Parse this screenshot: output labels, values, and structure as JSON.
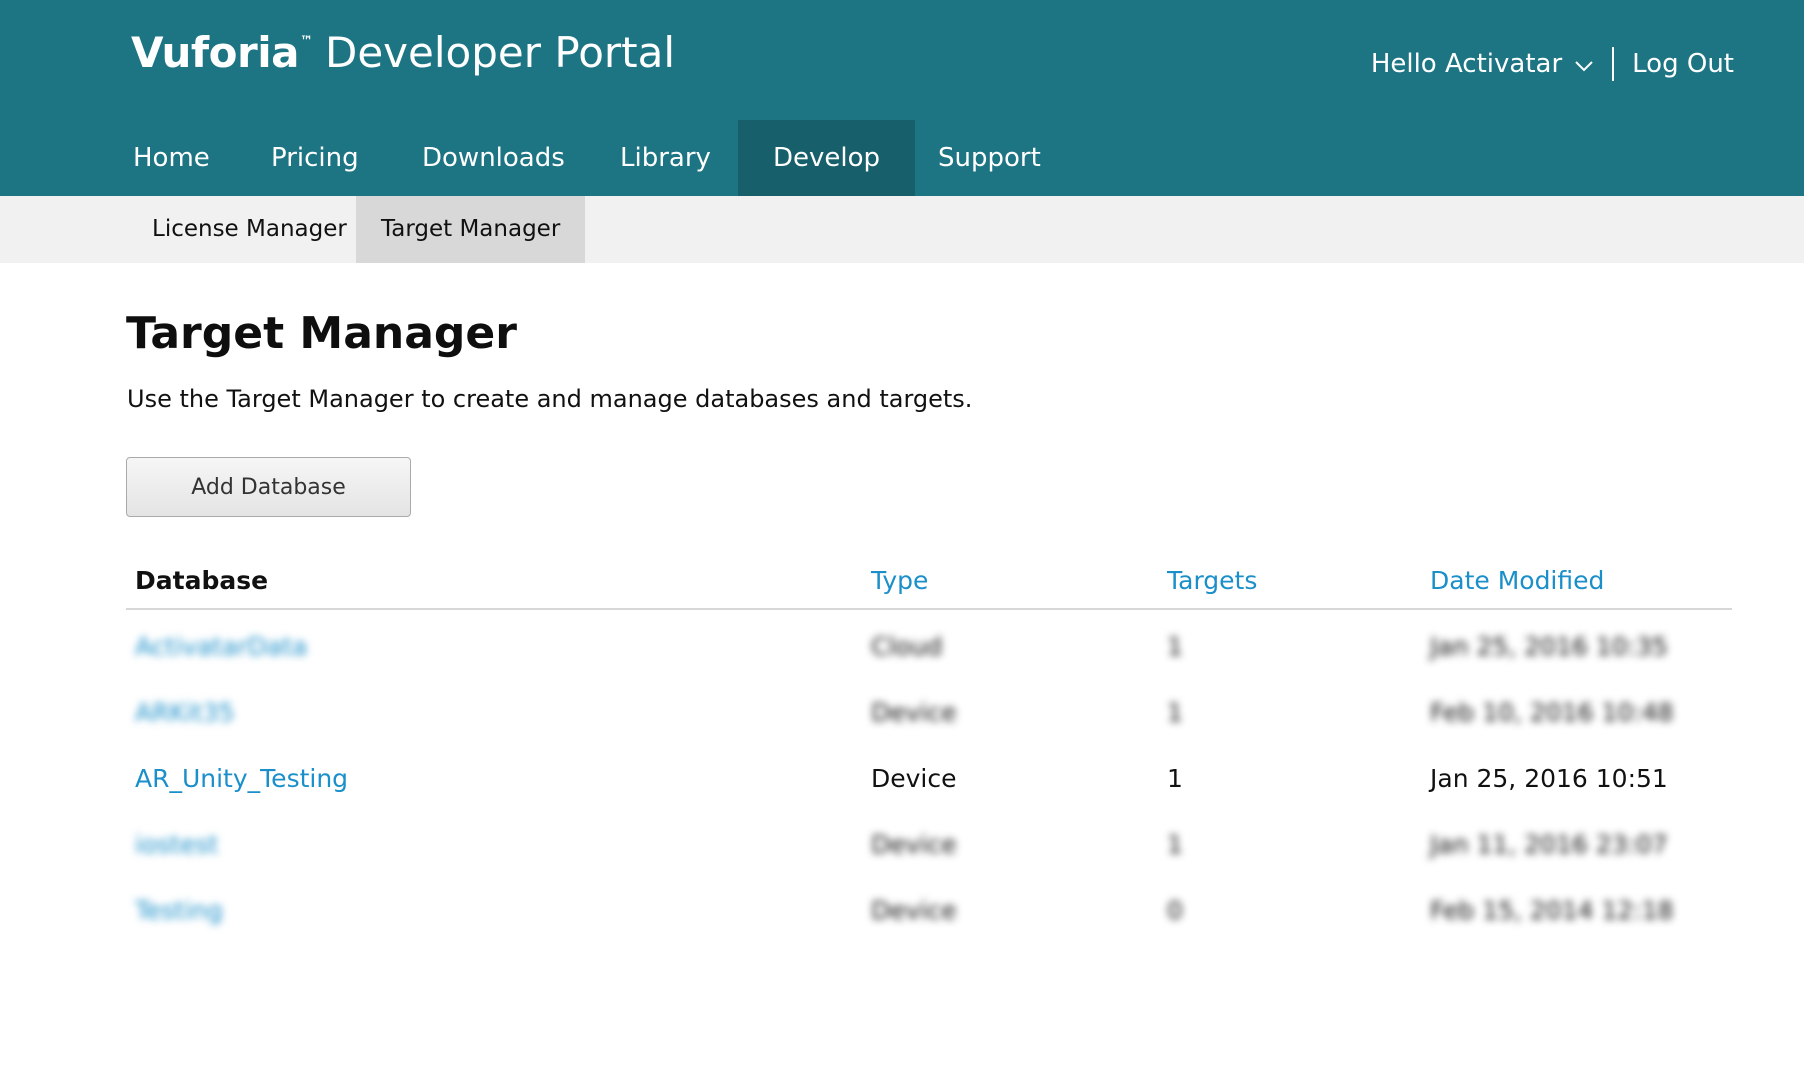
{
  "header": {
    "brand_logo": "Vuforia",
    "brand_tm": "™",
    "brand_portal": "Developer Portal",
    "user_greeting": "Hello Activatar",
    "logout_label": "Log Out"
  },
  "nav": {
    "items": [
      {
        "label": "Home"
      },
      {
        "label": "Pricing"
      },
      {
        "label": "Downloads"
      },
      {
        "label": "Library"
      },
      {
        "label": "Develop",
        "active": true
      },
      {
        "label": "Support"
      }
    ]
  },
  "subnav": {
    "items": [
      {
        "label": "License Manager"
      },
      {
        "label": "Target Manager",
        "active": true
      }
    ]
  },
  "main": {
    "title": "Target Manager",
    "description": "Use the Target Manager to create and manage databases and targets.",
    "add_button": "Add Database"
  },
  "table": {
    "headers": {
      "database": "Database",
      "type": "Type",
      "targets": "Targets",
      "date_modified": "Date Modified"
    },
    "rows": [
      {
        "name": "ActivatarData",
        "type": "Cloud",
        "targets": "1",
        "date": "Jan 25, 2016 10:35",
        "blurred": true
      },
      {
        "name": "ARKit35",
        "type": "Device",
        "targets": "1",
        "date": "Feb 10, 2016 10:48",
        "blurred": true
      },
      {
        "name": "AR_Unity_Testing",
        "type": "Device",
        "targets": "1",
        "date": "Jan 25, 2016 10:51",
        "blurred": false
      },
      {
        "name": "iostest",
        "type": "Device",
        "targets": "1",
        "date": "Jan 11, 2016 23:07",
        "blurred": true
      },
      {
        "name": "Testing",
        "type": "Device",
        "targets": "0",
        "date": "Feb 15, 2014 12:18",
        "blurred": true
      }
    ]
  },
  "colors": {
    "header_bg": "#1d7584",
    "nav_active_bg": "#175f6b",
    "link": "#1b8fc9",
    "subnav_bg": "#f1f1f1",
    "subnav_active_bg": "#d8d8d8"
  },
  "icons": {
    "user_menu": "chevron-down-icon"
  }
}
